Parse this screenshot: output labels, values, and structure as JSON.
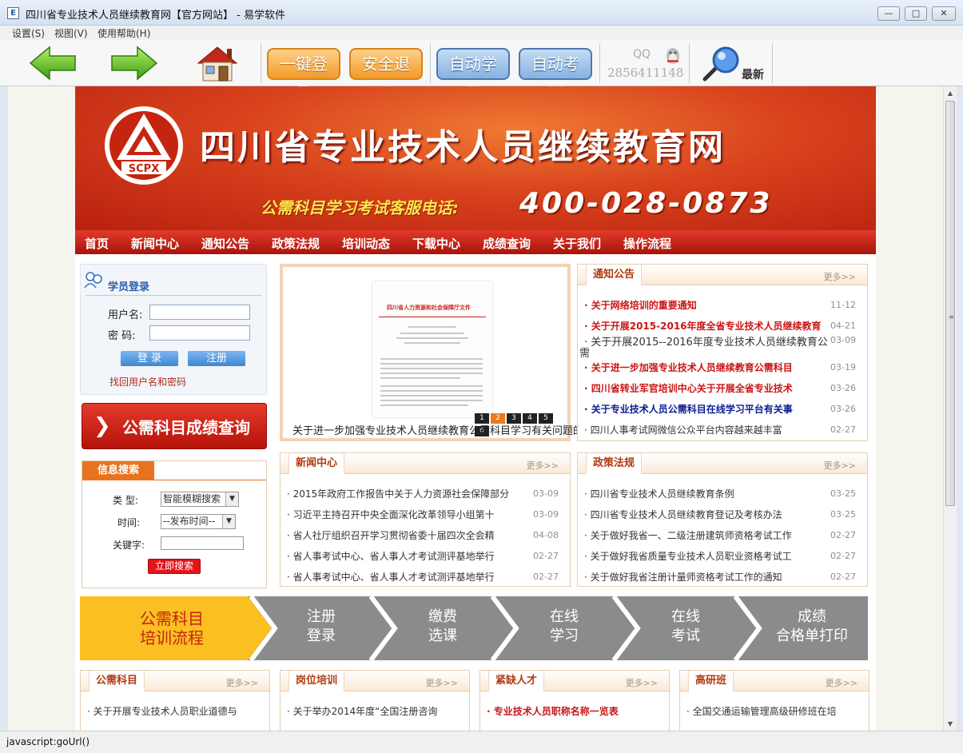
{
  "window": {
    "title": "四川省专业技术人员继续教育网【官方网站】 - 易学软件",
    "controls": [
      "—",
      "□",
      "✕"
    ]
  },
  "menu": [
    "设置(S)",
    "视图(V)",
    "使用帮助(H)"
  ],
  "toolbar": {
    "login": "一键登录",
    "logout": "安全退出",
    "auto_study": "自动学习",
    "auto_exam": "自动考试",
    "qq_label": "QQ",
    "qq_number": "2856411148",
    "latest": "最新"
  },
  "banner": {
    "logo_text": "SCPX",
    "site_name": "四川省专业技术人员继续教育网",
    "hotline_label": "公需科目学习考试客服电话:",
    "hotline": "400-028-0873"
  },
  "nav": [
    "首页",
    "新闻中心",
    "通知公告",
    "政策法规",
    "培训动态",
    "下载中心",
    "成绩查询",
    "关于我们",
    "操作流程"
  ],
  "login_box": {
    "title": "学员登录",
    "username_label": "用户名:",
    "password_label": "密  码:",
    "login_btn": "登 录",
    "register_btn": "注册",
    "forgot": "找回用户名和密码"
  },
  "score_query": "公需科目成绩查询",
  "search_box": {
    "title": "信息搜索",
    "type_label": "类  型:",
    "type_value": "智能模糊搜索",
    "time_label": "时间:",
    "time_value": "--发布时间--",
    "keyword_label": "关键字:",
    "submit": "立即搜索"
  },
  "slideshow": {
    "doc_title": "四川省人力资源和社会保障厅文件",
    "pages": [
      "1",
      "2",
      "3",
      "4",
      "5",
      "6"
    ],
    "active_page": 2,
    "caption": "关于进一步加强专业技术人员继续教育公需科目学习有关问题的"
  },
  "notices": {
    "title": "通知公告",
    "more": "更多>>",
    "items": [
      {
        "text": "· 关于网络培训的重要通知",
        "date": "11-12",
        "style": "red"
      },
      {
        "text": "· 关于开展2015-2016年度全省专业技术人员继续教育",
        "date": "04-21",
        "style": "red"
      },
      {
        "text": "· 关于开展2015--2016年度专业技术人员继续教育公",
        "date": "03-09",
        "style": "plain"
      },
      {
        "text": "需",
        "date": "",
        "style": "plain"
      },
      {
        "text": "· 关于进一步加强专业技术人员继续教育公需科目",
        "date": "03-19",
        "style": "red"
      },
      {
        "text": "· 四川省转业军官培训中心关于开展全省专业技术",
        "date": "03-26",
        "style": "red"
      },
      {
        "text": "· 关于专业技术人员公需科目在线学习平台有关事",
        "date": "03-26",
        "style": "blue"
      },
      {
        "text": "· 四川人事考试网微信公众平台内容越来越丰富",
        "date": "02-27",
        "style": "plain"
      }
    ]
  },
  "news": {
    "title": "新闻中心",
    "more": "更多>>",
    "items": [
      {
        "text": "· 2015年政府工作报告中关于人力资源社会保障部分",
        "date": "03-09"
      },
      {
        "text": "· 习近平主持召开中央全面深化改革领导小组第十",
        "date": "03-09"
      },
      {
        "text": "· 省人社厅组织召开学习贯彻省委十届四次全会精",
        "date": "04-08"
      },
      {
        "text": "· 省人事考试中心、省人事人才考试测评基地举行",
        "date": "02-27"
      },
      {
        "text": "· 省人事考试中心、省人事人才考试测评基地举行",
        "date": "02-27"
      }
    ]
  },
  "policy": {
    "title": "政策法规",
    "more": "更多>>",
    "items": [
      {
        "text": "· 四川省专业技术人员继续教育条例",
        "date": "03-25"
      },
      {
        "text": "· 四川省专业技术人员继续教育登记及考核办法",
        "date": "03-25"
      },
      {
        "text": "· 关于做好我省一、二级注册建筑师资格考试工作",
        "date": "02-27"
      },
      {
        "text": "· 关于做好我省质量专业技术人员职业资格考试工",
        "date": "02-27"
      },
      {
        "text": "· 关于做好我省注册计量师资格考试工作的通知",
        "date": "02-27"
      }
    ]
  },
  "flow": {
    "first": [
      "公需科目",
      "培训流程"
    ],
    "steps": [
      [
        "注册",
        "登录"
      ],
      [
        "缴费",
        "选课"
      ],
      [
        "在线",
        "学习"
      ],
      [
        "在线",
        "考试"
      ],
      [
        "成绩",
        "合格单打印"
      ]
    ]
  },
  "bottom_panels": [
    {
      "title": "公需科目",
      "more": "更多>>",
      "item": "· 关于开展专业技术人员职业道德与",
      "style": "plain"
    },
    {
      "title": "岗位培训",
      "more": "更多>>",
      "item": "· 关于举办2014年度“全国注册咨询",
      "style": "plain"
    },
    {
      "title": "紧缺人才",
      "more": "更多>>",
      "item": "· 专业技术人员职称名称一览表",
      "style": "red"
    },
    {
      "title": "高研班",
      "more": "更多>>",
      "item": "· 全国交通运输管理高级研修班在培",
      "style": "plain"
    }
  ],
  "statusbar": "javascript:goUrl()",
  "colors": {
    "banner_red": "#d8421d",
    "nav_red": "#c8241a",
    "accent_orange": "#e8731f",
    "flow_yellow": "#f7a71b",
    "flow_gray": "#8b8b8b"
  }
}
